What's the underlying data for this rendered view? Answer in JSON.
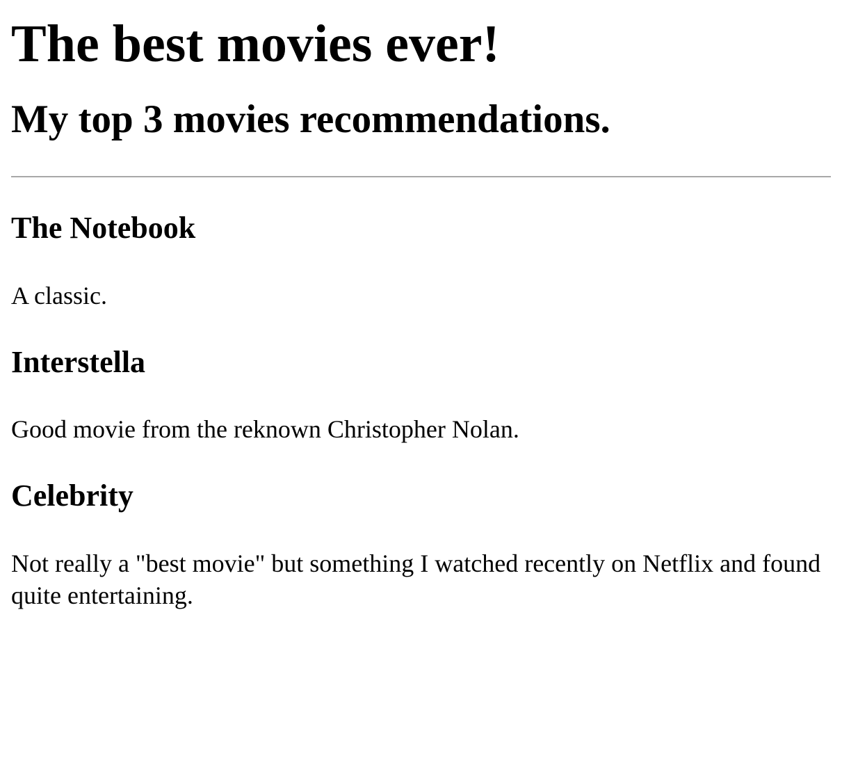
{
  "header": {
    "title": "The best movies ever!",
    "subtitle": "My top 3 movies recommendations."
  },
  "movies": [
    {
      "title": "The Notebook",
      "description": "A classic."
    },
    {
      "title": "Interstella",
      "description": "Good movie from the reknown Christopher Nolan."
    },
    {
      "title": "Celebrity",
      "description": "Not really a \"best movie\" but something I watched recently on Netflix and found quite entertaining."
    }
  ]
}
